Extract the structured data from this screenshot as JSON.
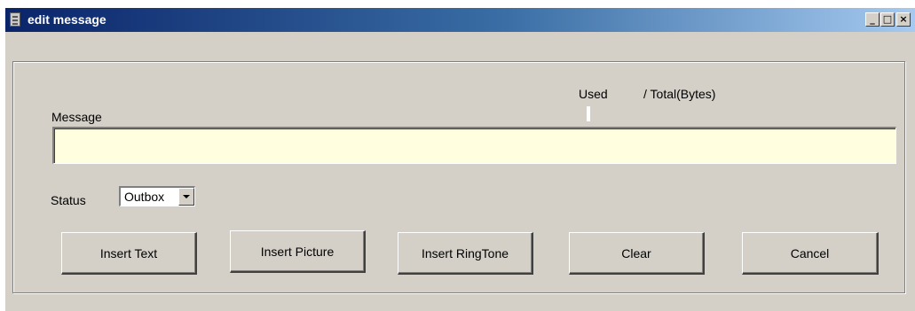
{
  "window": {
    "title": "edit message",
    "minimize_label": "_",
    "maximize_label": "□",
    "close_label": "×"
  },
  "form": {
    "used_label": "Used",
    "total_label": "/ Total(Bytes)",
    "message_label": "Message",
    "message_value": "",
    "status_label": "Status",
    "status_selected": "Outbox"
  },
  "buttons": {
    "insert_text": "Insert Text",
    "insert_picture": "Insert Picture",
    "insert_ringtone": "Insert RingTone",
    "clear": "Clear",
    "cancel": "Cancel"
  },
  "colors": {
    "titlebar_start": "#0a246a",
    "titlebar_end": "#a6caf0",
    "face": "#d4d0c8",
    "message_field_bg": "#ffffe0"
  }
}
